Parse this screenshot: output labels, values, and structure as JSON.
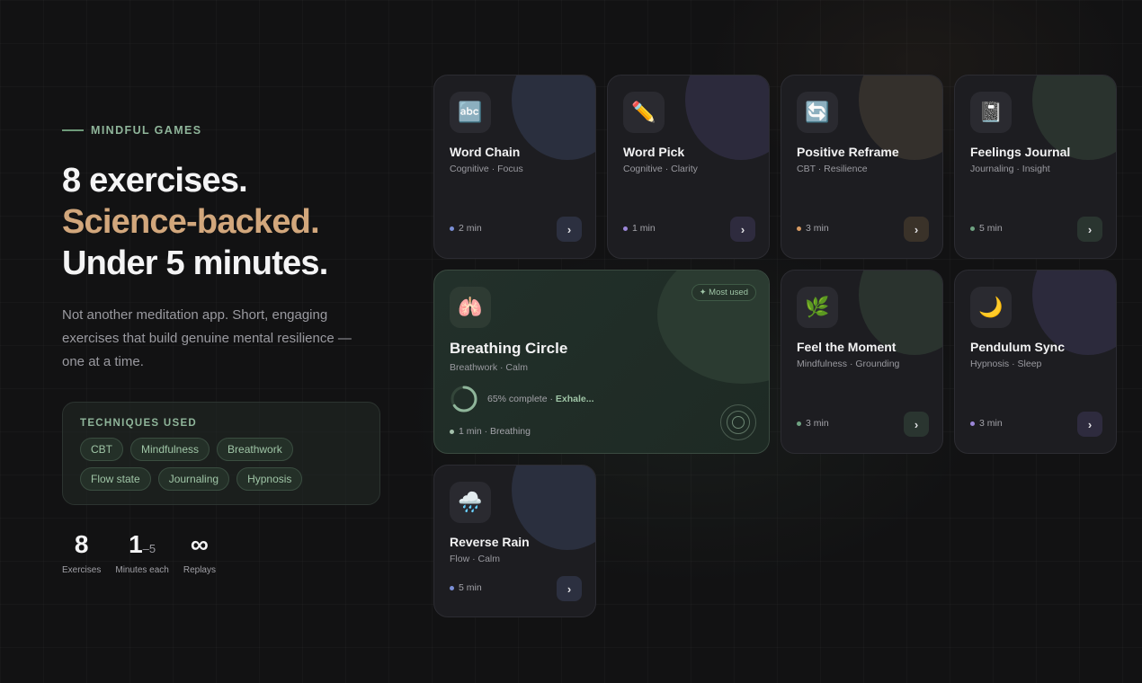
{
  "hero": {
    "eyebrow": "MINDFUL GAMES",
    "line1": "8 exercises.",
    "line2": "Science-backed.",
    "line3": "Under 5 minutes.",
    "description": "Not another meditation app. Short, engaging exercises that build genuine mental resilience — one at a time."
  },
  "techniques": {
    "title": "TECHNIQUES USED",
    "items": [
      "CBT",
      "Mindfulness",
      "Breathwork",
      "Flow state",
      "Journaling",
      "Hypnosis"
    ]
  },
  "stats": [
    {
      "value": "8",
      "suffix": "",
      "label": "Exercises"
    },
    {
      "value": "1",
      "suffix": "–5",
      "label": "Minutes each"
    },
    {
      "value": "∞",
      "suffix": "",
      "label": "Replays"
    }
  ],
  "colors": {
    "accent_green": "#8fb59a",
    "accent_tan": "#d2a77c",
    "dot_blue": "#7b8fd6",
    "dot_purple": "#9b86d8",
    "dot_orange": "#d79a62",
    "dot_green": "#6fa382"
  },
  "cards": [
    {
      "icon": "abc-icon",
      "glyph": "🔤",
      "title": "Word Chain",
      "subtitle": "Cognitive · Focus",
      "meta": "2 min"
    },
    {
      "icon": "pencil-icon",
      "glyph": "✏️",
      "title": "Word Pick",
      "subtitle": "Cognitive · Clarity",
      "meta": "1 min"
    },
    {
      "icon": "reframe-icon",
      "glyph": "🔄",
      "title": "Positive Reframe",
      "subtitle": "CBT · Resilience",
      "meta": "3 min"
    },
    {
      "icon": "notebook-icon",
      "glyph": "📓",
      "title": "Feelings Journal",
      "subtitle": "Journaling · Insight",
      "meta": "5 min"
    },
    {
      "icon": "lungs-icon",
      "glyph": "🫁",
      "title": "Breathing Circle",
      "subtitle": "Breathwork · Calm",
      "meta": "1 min · Breathing",
      "badge": "✦ Most used",
      "progress_text": "65% complete · ",
      "progress_status": "Exhale...",
      "progress_value": 0.65
    },
    {
      "icon": "herb-icon",
      "glyph": "🌿",
      "title": "Feel the Moment",
      "subtitle": "Mindfulness · Grounding",
      "meta": "3 min"
    },
    {
      "icon": "moon-icon",
      "glyph": "🌙",
      "title": "Pendulum Sync",
      "subtitle": "Hypnosis · Sleep",
      "meta": "3 min"
    },
    {
      "icon": "rain-cloud-icon",
      "glyph": "🌧️",
      "title": "Reverse Rain",
      "subtitle": "Flow · Calm",
      "meta": "5 min"
    }
  ],
  "chevron": "›"
}
